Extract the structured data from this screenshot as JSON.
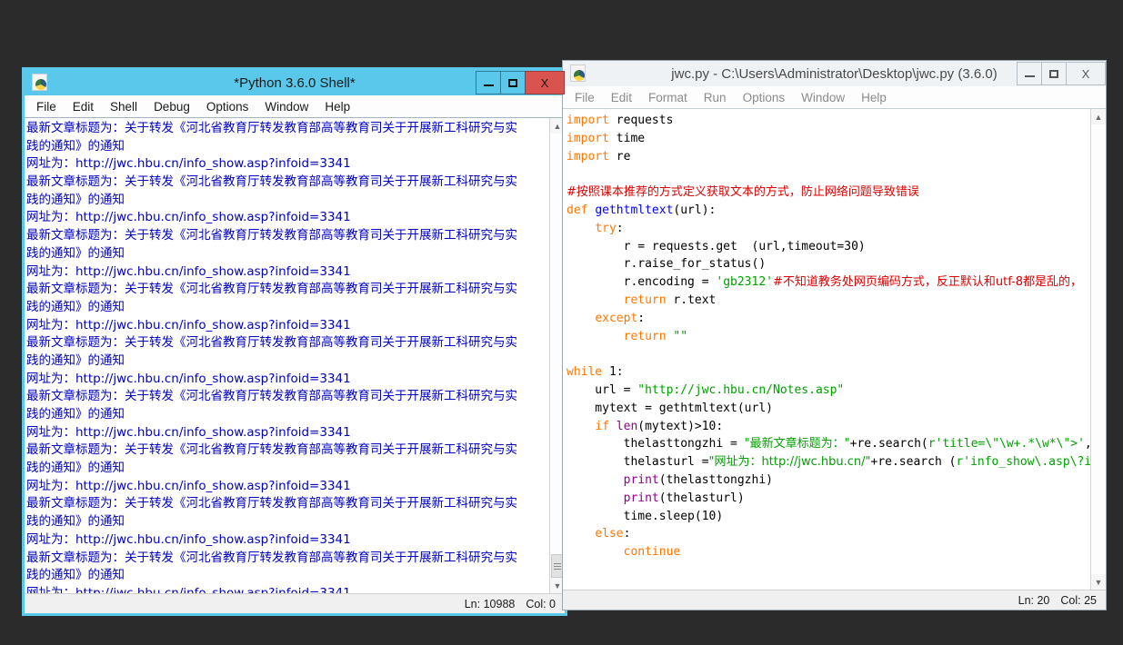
{
  "desktop": {
    "background": "#2b2b2b"
  },
  "shell_window": {
    "title": "*Python 3.6.0 Shell*",
    "icon": "python-logo-icon",
    "active": true,
    "accent_color": "#5ac8eb",
    "close_color": "#d9534f",
    "menu": [
      "File",
      "Edit",
      "Shell",
      "Debug",
      "Options",
      "Window",
      "Help"
    ],
    "buttons": {
      "minimize": "minimize-button",
      "maximize": "maximize-button",
      "close": "X"
    },
    "status": {
      "line_label": "Ln: 10988",
      "col_label": "Col: 0"
    },
    "output_text": {
      "title_line_a": "最新文章标题为：关于转发《河北省教育厅转发教育部高等教育司关于开展新工科研究与实",
      "title_line_b": "践的通知》的通知",
      "url_line": "网址为：http://jwc.hbu.cn/info_show.asp?infoid=3341"
    },
    "repeat_count": 9,
    "text_color": "#0000c0"
  },
  "editor_window": {
    "title": "jwc.py - C:\\Users\\Administrator\\Desktop\\jwc.py (3.6.0)",
    "icon": "python-logo-icon",
    "active": false,
    "menu": [
      "File",
      "Edit",
      "Format",
      "Run",
      "Options",
      "Window",
      "Help"
    ],
    "buttons": {
      "minimize": "minimize-button",
      "maximize": "maximize-button",
      "close": "X"
    },
    "status": {
      "line_label": "Ln: 20",
      "col_label": "Col: 25"
    },
    "code_lines": [
      [
        {
          "t": "import",
          "c": "kw"
        },
        {
          "t": " requests",
          "c": ""
        }
      ],
      [
        {
          "t": "import",
          "c": "kw"
        },
        {
          "t": " time",
          "c": ""
        }
      ],
      [
        {
          "t": "import",
          "c": "kw"
        },
        {
          "t": " re",
          "c": ""
        }
      ],
      [],
      [
        {
          "t": "#按照课本推荐的方式定义获取文本的方式，防止网络问题导致错误",
          "c": "com cjk"
        }
      ],
      [
        {
          "t": "def",
          "c": "kw"
        },
        {
          "t": " ",
          "c": ""
        },
        {
          "t": "gethtmltext",
          "c": "def"
        },
        {
          "t": "(url):",
          "c": ""
        }
      ],
      [
        {
          "t": "    ",
          "c": ""
        },
        {
          "t": "try",
          "c": "kw"
        },
        {
          "t": ":",
          "c": ""
        }
      ],
      [
        {
          "t": "        r = requests.get  (url,timeout=30)",
          "c": ""
        }
      ],
      [
        {
          "t": "        r.raise_for_status()",
          "c": ""
        }
      ],
      [
        {
          "t": "        r.encoding = ",
          "c": ""
        },
        {
          "t": "'gb2312'",
          "c": "str"
        },
        {
          "t": "#不知道教务处网页编码方式，反正默认和utf-8都是乱的，",
          "c": "com cjk"
        }
      ],
      [
        {
          "t": "        ",
          "c": ""
        },
        {
          "t": "return",
          "c": "kw"
        },
        {
          "t": " r.text",
          "c": ""
        }
      ],
      [
        {
          "t": "    ",
          "c": ""
        },
        {
          "t": "except",
          "c": "kw"
        },
        {
          "t": ":",
          "c": ""
        }
      ],
      [
        {
          "t": "        ",
          "c": ""
        },
        {
          "t": "return",
          "c": "kw"
        },
        {
          "t": " ",
          "c": ""
        },
        {
          "t": "\"\"",
          "c": "str"
        }
      ],
      [],
      [
        {
          "t": "while",
          "c": "kw"
        },
        {
          "t": " 1:",
          "c": ""
        }
      ],
      [
        {
          "t": "    url = ",
          "c": ""
        },
        {
          "t": "\"http://jwc.hbu.cn/Notes.asp\"",
          "c": "str"
        }
      ],
      [
        {
          "t": "    mytext = gethtmltext(url)",
          "c": ""
        }
      ],
      [
        {
          "t": "    ",
          "c": ""
        },
        {
          "t": "if",
          "c": "kw"
        },
        {
          "t": " ",
          "c": ""
        },
        {
          "t": "len",
          "c": "bif"
        },
        {
          "t": "(mytext)>10:",
          "c": ""
        }
      ],
      [
        {
          "t": "        thelasttongzhi = ",
          "c": ""
        },
        {
          "t": "\"最新文章标题为：\"",
          "c": "str cjk"
        },
        {
          "t": "+re.search(",
          "c": ""
        },
        {
          "t": "r'title=\\\"\\w+.*\\w*\\\">'",
          "c": "str"
        },
        {
          "t": ",myt",
          "c": ""
        }
      ],
      [
        {
          "t": "        thelasturl =",
          "c": ""
        },
        {
          "t": "\"网址为：http://jwc.hbu.cn/\"",
          "c": "str cjk"
        },
        {
          "t": "+re.search (",
          "c": ""
        },
        {
          "t": "r'info_show\\.asp\\?in",
          "c": "str"
        }
      ],
      [
        {
          "t": "        ",
          "c": ""
        },
        {
          "t": "print",
          "c": "bif"
        },
        {
          "t": "(thelasttongzhi)",
          "c": ""
        }
      ],
      [
        {
          "t": "        ",
          "c": ""
        },
        {
          "t": "print",
          "c": "bif"
        },
        {
          "t": "(thelasturl)",
          "c": ""
        }
      ],
      [
        {
          "t": "        time.sleep(10)",
          "c": ""
        }
      ],
      [
        {
          "t": "    ",
          "c": ""
        },
        {
          "t": "else",
          "c": "kw"
        },
        {
          "t": ":",
          "c": ""
        }
      ],
      [
        {
          "t": "        ",
          "c": ""
        },
        {
          "t": "continue",
          "c": "kw"
        }
      ]
    ]
  }
}
